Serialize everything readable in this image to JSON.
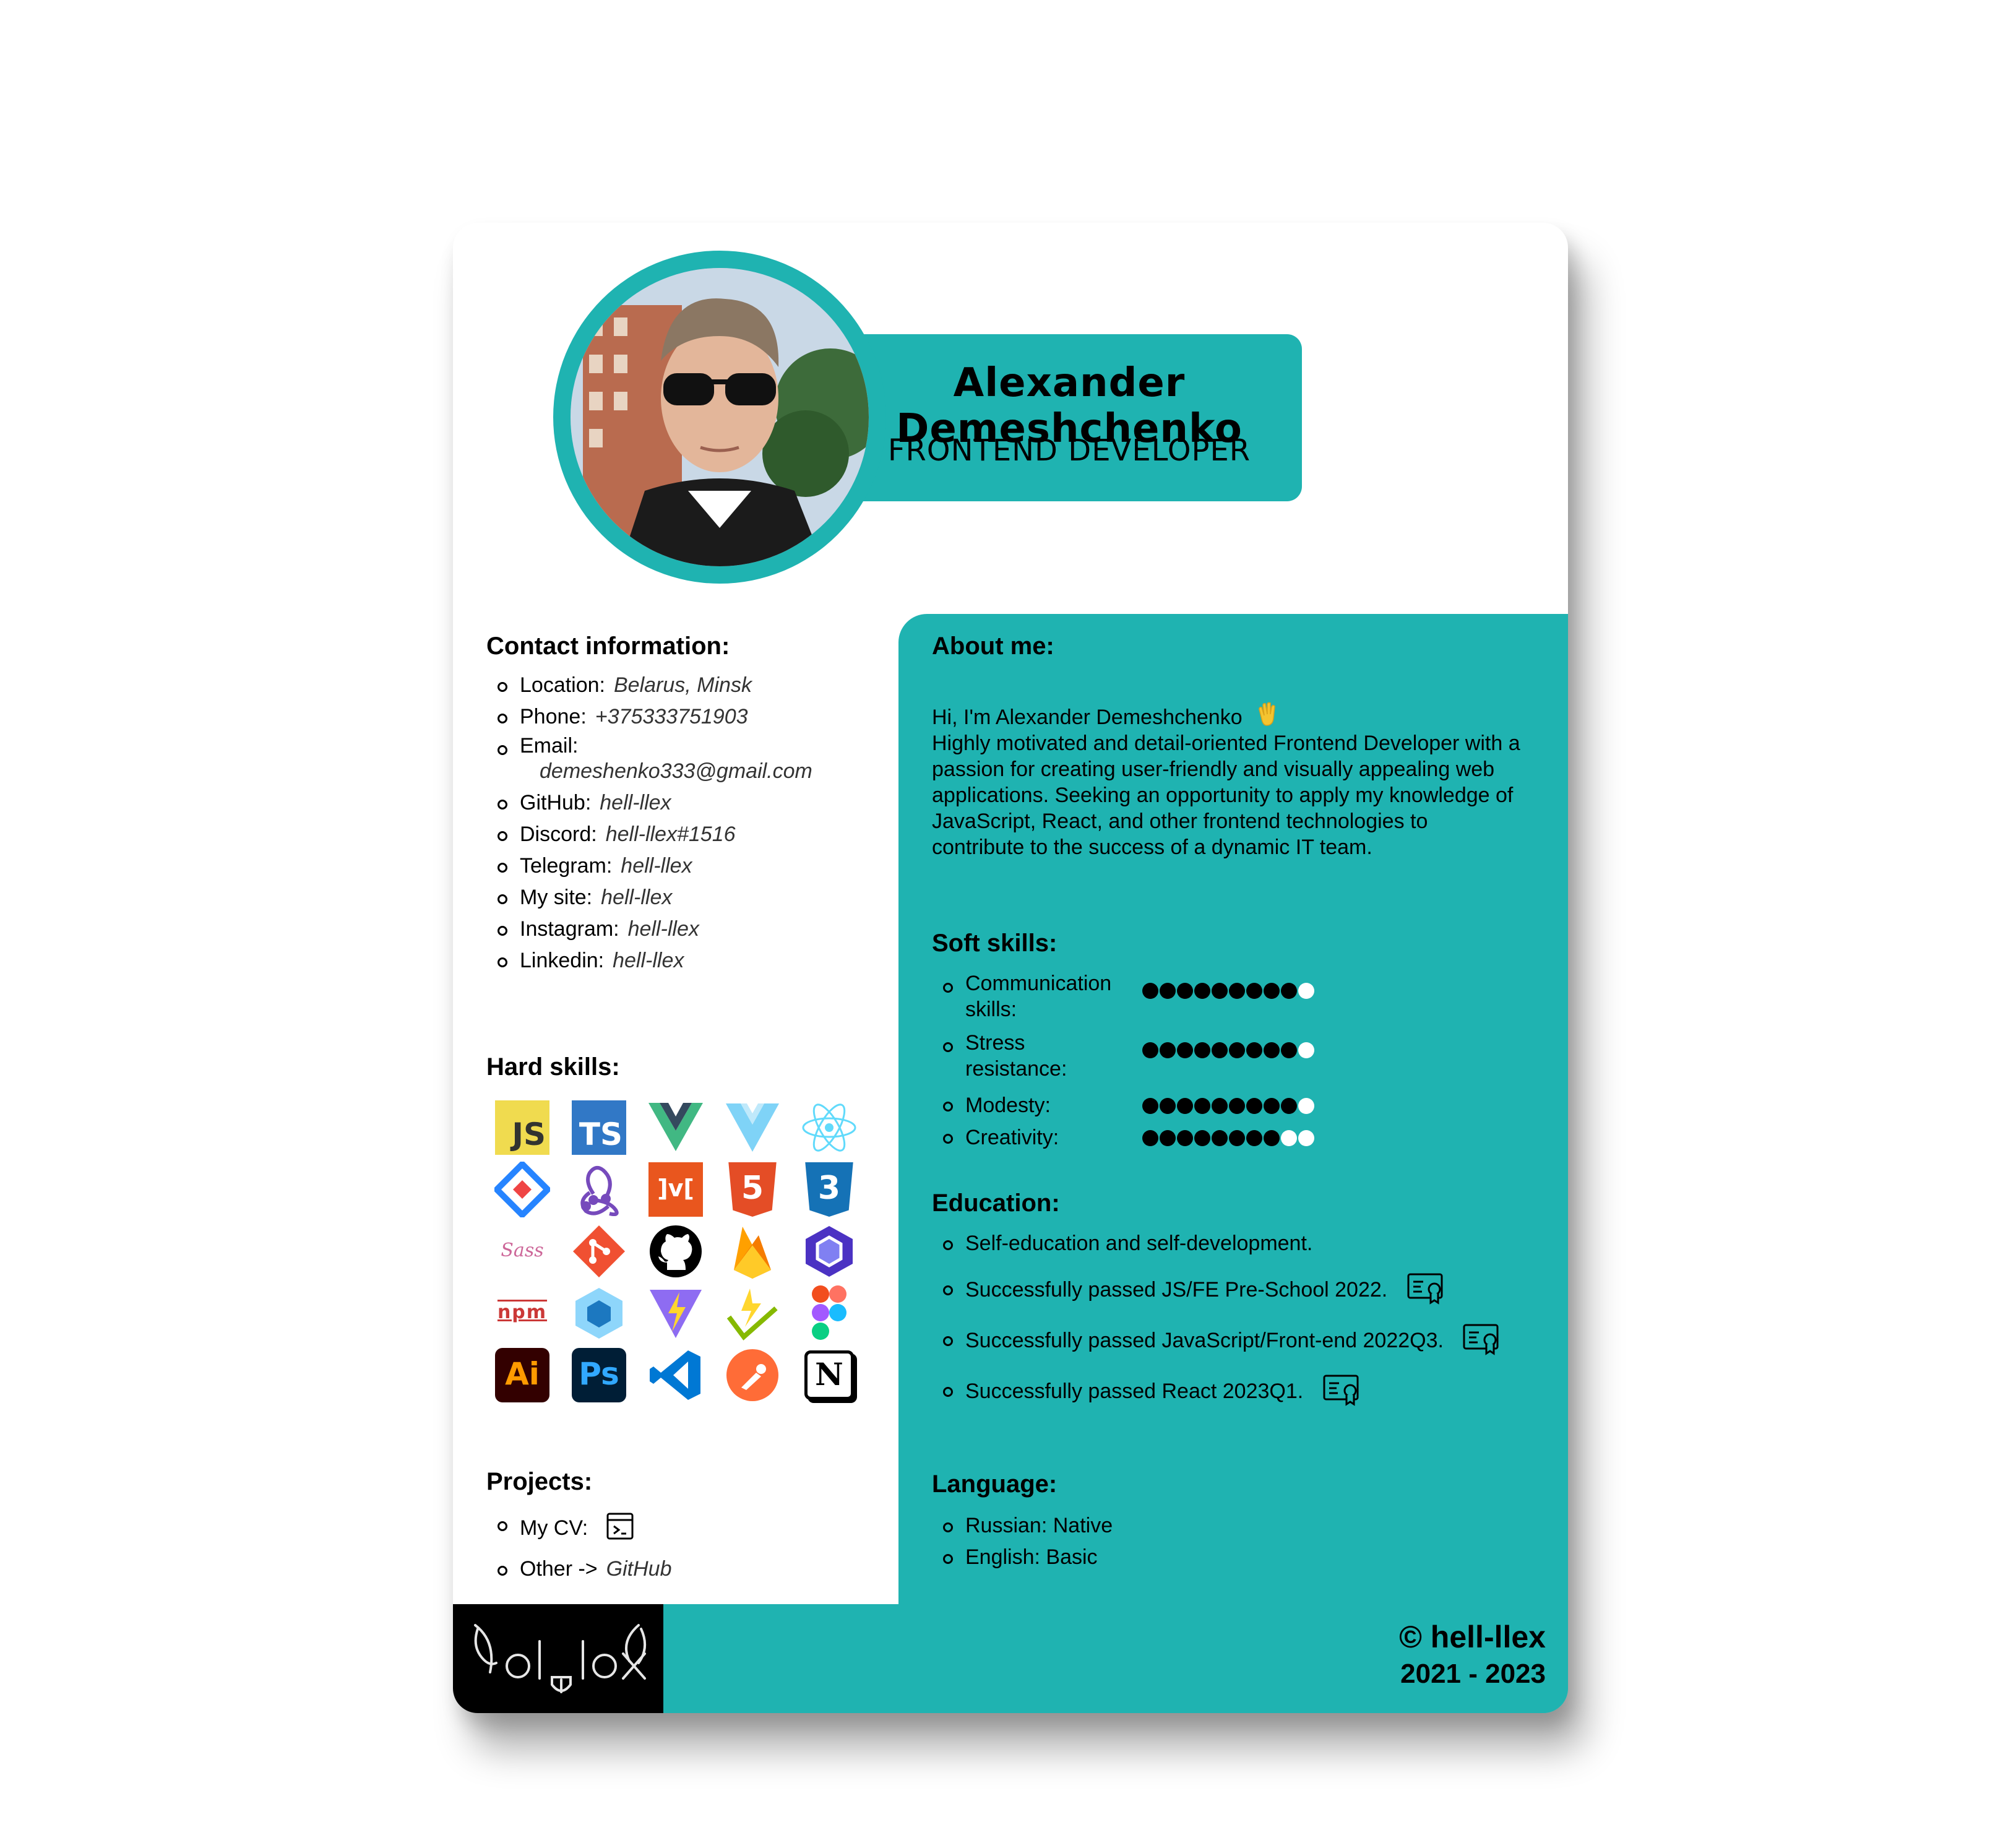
{
  "header": {
    "name": "Alexander Demeshchenko",
    "role": "FRONTEND DEVELOPER"
  },
  "contact": {
    "title": "Contact information:",
    "items": [
      {
        "label": "Location:",
        "value": "Belarus, Minsk"
      },
      {
        "label": "Phone:",
        "value": "+375333751903"
      },
      {
        "label": "Email:",
        "value": "demeshenko333@gmail.com"
      },
      {
        "label": "GitHub:",
        "value": "hell-llex"
      },
      {
        "label": "Discord:",
        "value": "hell-llex#1516"
      },
      {
        "label": "Telegram:",
        "value": "hell-llex"
      },
      {
        "label": "My site:",
        "value": "hell-llex"
      },
      {
        "label": "Instagram:",
        "value": "hell-llex"
      },
      {
        "label": "Linkedin:",
        "value": "hell-llex"
      }
    ]
  },
  "hard_skills": {
    "title": "Hard skills:",
    "icons": [
      {
        "name": "javascript-icon",
        "text": "JS",
        "bg": "#f0db4f",
        "fg": "#323330"
      },
      {
        "name": "typescript-icon",
        "text": "TS",
        "bg": "#3178c6",
        "fg": "#ffffff"
      },
      {
        "name": "vue-icon"
      },
      {
        "name": "vite-icon"
      },
      {
        "name": "react-icon"
      },
      {
        "name": "jira-icon"
      },
      {
        "name": "redux-icon"
      },
      {
        "name": "mvc-icon",
        "text": "]v[",
        "bg": "#e9561e",
        "fg": "#ffffff"
      },
      {
        "name": "html5-icon",
        "text": "5",
        "bg": "#e44d26",
        "fg": "#ffffff"
      },
      {
        "name": "css3-icon",
        "text": "3",
        "bg": "#1572b6",
        "fg": "#ffffff"
      },
      {
        "name": "sass-icon",
        "text": "Sass",
        "fg": "#cd6799"
      },
      {
        "name": "git-icon"
      },
      {
        "name": "github-icon"
      },
      {
        "name": "firebase-icon"
      },
      {
        "name": "eslint-icon"
      },
      {
        "name": "npm-icon",
        "text": "npm",
        "fg": "#cb3837"
      },
      {
        "name": "webpack-icon"
      },
      {
        "name": "vite-bolt-icon"
      },
      {
        "name": "gulp-check-icon"
      },
      {
        "name": "figma-icon"
      },
      {
        "name": "illustrator-icon",
        "text": "Ai",
        "bg": "#330000",
        "fg": "#ff9a00"
      },
      {
        "name": "photoshop-icon",
        "text": "Ps",
        "bg": "#001e36",
        "fg": "#31a8ff"
      },
      {
        "name": "vscode-icon"
      },
      {
        "name": "postman-icon"
      },
      {
        "name": "notion-icon",
        "text": "N",
        "bg": "#ffffff",
        "fg": "#000000"
      }
    ]
  },
  "projects": {
    "title": "Projects:",
    "items": [
      {
        "label": "My CV:"
      },
      {
        "label": "Other ->",
        "value": "GitHub"
      }
    ]
  },
  "about": {
    "title": "About me:",
    "greeting": "Hi, I'm Alexander Demeshchenko",
    "text": "Highly motivated and detail-oriented Frontend Developer with a passion for creating user-friendly and visually appealing web applications. Seeking an opportunity to apply my knowledge of JavaScript, React, and other frontend technologies to contribute to the success of a dynamic IT team."
  },
  "soft_skills": {
    "title": "Soft skills:",
    "max": 10,
    "items": [
      {
        "label_line1": "Communication",
        "label_line2": "skills:",
        "level": 9
      },
      {
        "label_line1": "Stress",
        "label_line2": "resistance:",
        "level": 9
      },
      {
        "label_line1": "Modesty:",
        "label_line2": "",
        "level": 9
      },
      {
        "label_line1": "Creativity:",
        "label_line2": "",
        "level": 8
      }
    ]
  },
  "education": {
    "title": "Education:",
    "items": [
      {
        "text": "Self-education and self-development."
      },
      {
        "text": "Successfully passed JS/FE Pre-School 2022."
      },
      {
        "text": "Successfully passed JavaScript/Front-end 2022Q3."
      },
      {
        "text": "Successfully passed React 2023Q1."
      }
    ]
  },
  "language": {
    "title": "Language:",
    "items": [
      "Russian: Native",
      "English: Basic"
    ]
  },
  "footer": {
    "copyright": "© hell-llex",
    "years": "2021 - 2023"
  },
  "colors": {
    "accent": "#1fb3b1",
    "footer_logo_bg": "#000000"
  }
}
